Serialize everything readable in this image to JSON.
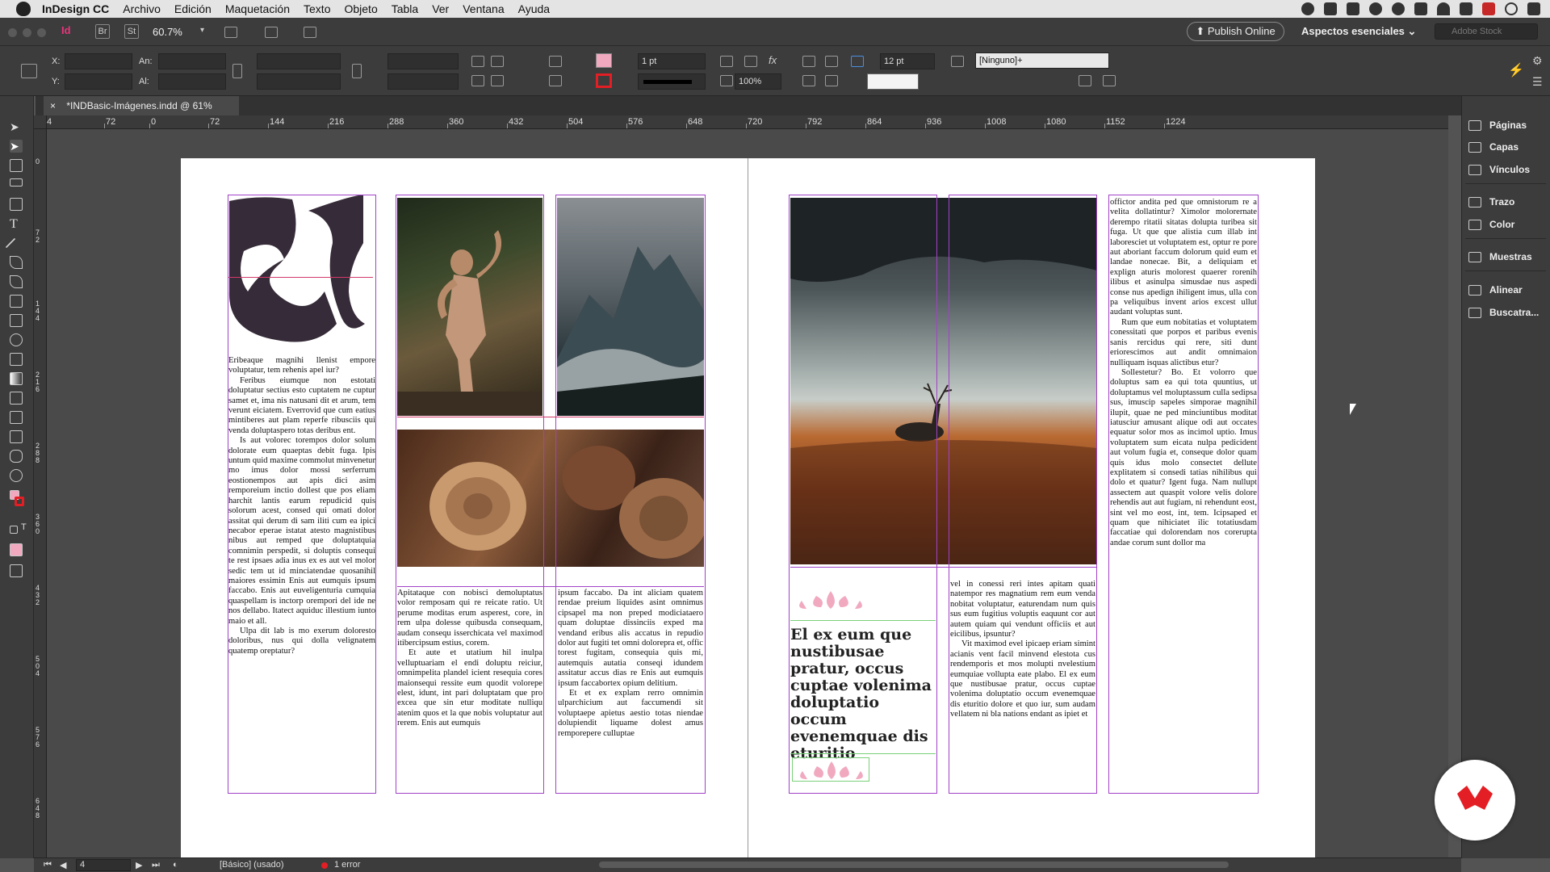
{
  "menubar": {
    "app_name": "InDesign CC",
    "items": [
      "Archivo",
      "Edición",
      "Maquetación",
      "Texto",
      "Objeto",
      "Tabla",
      "Ver",
      "Ventana",
      "Ayuda"
    ]
  },
  "appbar": {
    "app_badge": "Id",
    "bridge_label": "Br",
    "stock_label": "St",
    "zoom": "60.7%",
    "publish_label": "Publish Online",
    "workspace_label": "Aspectos esenciales",
    "search_placeholder": "Adobe Stock"
  },
  "control": {
    "x_label": "X:",
    "y_label": "Y:",
    "w_label": "An:",
    "h_label": "Al:",
    "stroke_weight": "1 pt",
    "opacity": "100%",
    "gap": "12 pt",
    "object_style": "[Ninguno]+"
  },
  "document_tab": {
    "title": "*INDBasic-Imágenes.indd @ 61%",
    "close": "×"
  },
  "ruler": {
    "h_ticks": [
      "4",
      "72",
      "0",
      "72",
      "144",
      "216",
      "288",
      "360",
      "432",
      "504",
      "576",
      "648",
      "720",
      "792",
      "864",
      "936",
      "1008",
      "1080",
      "1152",
      "1224"
    ],
    "v_ticks": [
      "0",
      "7 2",
      "1 4 4",
      "2 1 6",
      "2 8 8",
      "3 6 0",
      "4 3 2",
      "5 0 4",
      "5 7 6",
      "6 4 8"
    ]
  },
  "panels": [
    {
      "label": "Páginas",
      "icon": "pages-icon"
    },
    {
      "label": "Capas",
      "icon": "layers-icon"
    },
    {
      "label": "Vínculos",
      "icon": "links-icon"
    },
    {
      "label": "Trazo",
      "icon": "stroke-icon"
    },
    {
      "label": "Color",
      "icon": "color-icon"
    },
    {
      "label": "Muestras",
      "icon": "swatches-icon"
    },
    {
      "label": "Alinear",
      "icon": "align-icon"
    },
    {
      "label": "Buscatra...",
      "icon": "pathfinder-icon"
    }
  ],
  "status": {
    "page": "4",
    "style": "[Básico] (usado)",
    "errors": "1 error"
  },
  "spread": {
    "left_col1": [
      "Eribeaque magnihi llenist empore voluptatur, tem rehenis apel iur?",
      "Feribus eiumque non estotati doluptatur sectius esto cuptatem ne cuptur samet et, ima nis natusani dit et arum, tem verunt eiciatem. Everrovid que cum eatius mintiberes aut plam reperfe ribusciis qui venda doluptaspero totas deribus ent.",
      "Is aut volorec torempos dolor solum dolorate eum quaeptas debit fuga. Ipis untum quid maxime commolut minvenetur mo imus dolor mossi serferrum eostionempos aut apis dici asim remporeium inctio dollest que pos eliam harchit lantis earum repudicid quis solorum acest, consed qui omati dolor assitat qui derum di sam iliti cum ea ipici necabor eperae istatat atesto magnistibus nibus aut remped que doluptatquia comnimin perspedit, si doluptis consequi te rest ipsaes adia inus ex es aut vel molor sedic tem ut id minciatendae quosanihil maiores essimin Enis aut eumquis ipsum faccabo. Enis aut euveligenturia cumquia quaspellam is inctorp orempori del ide ne nos dellabo. Itatect aquiduc illestium iunto maio et all.",
      "Ulpa dit lab is mo exerum doloresto doloribus, nus qui dolla velignatem quatemp oreptatur?"
    ],
    "left_col2": [
      "Apitataque con nobisci demoluptatus volor remposam qui re reicate ratio. Ut perume moditas erum asperest, core, in rem ulpa dolesse quibusda consequam, audam consequ isserchicata vel maximod itibercipsum estius, corem.",
      "Et aute et utatium hil inulpa velluptuariam el endi doluptu reiciur, omnimpelita plandel icient resequia cores maionsequi ressite eum quodit volorepe elest, idunt, int pari doluptatam que pro excea que sin etur moditate nulliqu atenim quos et la que nobis voluptatur aut rerem. Enis aut eumquis"
    ],
    "left_col3": [
      "ipsum faccabo. Da int aliciam quatem rendae preium liquides asint omnimus cipsapel ma non preped modiciataero quam doluptae dissinciis exped ma vendand eribus alis accatus in repudio dolor aut fugiti tet omni dolorepra et, offic torest fugitam, consequia quis mi, autemquis autatia conseqi idundem assitatur accus dias re Enis aut eumquis ipsum faccabortex opium delitium.",
      "Et et ex explam rerro omnimin ulparchicium aut faccumendi sit voluptaepe apietus aestio totas niendae dolupiendit liquame dolest amus remporepere culluptae"
    ],
    "right_heading": "El ex eum que nustibusae pratur, occus cuptae volenima doluptatio occum evenemquae dis eturitio",
    "right_col2": [
      "vel in conessi reri intes apitam quati natempor res magnatium rem eum venda nobitat voluptatur, eaturendam num quis sus eum fugitius voluptis eaquunt cor aut autem quiam qui vendunt officiis et aut eicilibus, ipsuntur?",
      "Vit maximod evel ipicaep eriam simint acianis vent facil minvend elestota cus rendemporis et mos molupti nvelestium eumquiae vollupta eate plabo. El ex eum que nustibusae pratur, occus cuptae volenima doluptatio occum evenemquae dis eturitio dolore et quo iur, sum audam vellatem ni bla nations endant as ipiet et"
    ],
    "right_col3": [
      "offictor andita ped que omnistorum re a velita dollatintur? Ximolor molorernate derempo ritatii sitatas dolupta turibea sit fuga. Ut que que alistia cum illab int laboresciet ut voluptatem est, optur re pore aut aboriant faccum dolorum quid eum et landae nonecae. Bit, a deliquiam et explign aturis molorest quaerer rorenih ilibus et asinulpa simusdae nus aspedi conse nus apedign ihiligent imus, ulla con pa veliquibus invent arios excest ullut audant voluptas sunt.",
      "Rum que eum nobitatias et voluptatem conessitati que porpos et paribus evenis sanis rercidus qui rere, siti dunt eriorescimos aut andit omnimaion nulliquam isquas alictibus etur?",
      "Sollestetur? Bo. Et volorro que doluptus sam ea qui tota quuntius, ut doluptamus vel moluptassum culla sedipsa sus, imuscip sapeles simporae magnihil ilupit, quae ne ped minciuntibus moditat iatusciur amusant alique odi aut occates equatur solor mos as incimol uptio. Imus voluptatem sum eicata nulpa pedicident aut volum fugia et, conseque dolor quam quis idus molo consectet dellute explitatem si consedi tatias nihilibus qui dolo et quatur? Igent fuga. Nam nullupt assectem aut quaspit volore velis dolore rehendis aut aut fugiam, ni rehendunt eost, sint vel mo eost, int, tem. Icipsaped et quam que nihiciatet ilic totatiusdam faccatiae qui dolorendam nos corerupta andae corum sunt dollor ma"
    ]
  },
  "colors": {
    "frame_guide": "#a142c7",
    "accent_pink": "#f1a9c0",
    "badge_red": "#e31e24"
  }
}
